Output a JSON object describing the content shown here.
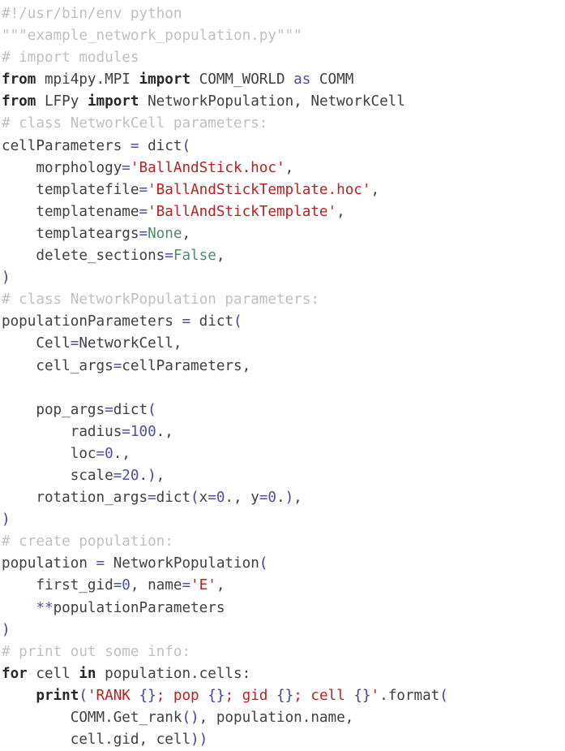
{
  "document": {
    "kind": "python-source-listing",
    "filename": "example_network_population.py",
    "language": "Python",
    "background_color": "#ffffff",
    "line_count": 30
  },
  "theme": {
    "plain": "#404044",
    "comment": "#c0c0c0",
    "keyword": "#26282c",
    "builtin": "#26282c",
    "string": "#ba2121",
    "operator": "#5050a0",
    "number": "#5050a0",
    "constant": "#4f8a6a",
    "brace": "#4040a8"
  },
  "lines": [
    {
      "n": 1,
      "text": "#!/usr/bin/env python",
      "tokens": [
        {
          "t": "#!/usr/bin/env python",
          "c": "comment"
        }
      ]
    },
    {
      "n": 2,
      "text": "\"\"\"example_network_population.py\"\"\"",
      "tokens": [
        {
          "t": "\"\"\"example_network_population.py\"\"\"",
          "c": "comment"
        }
      ]
    },
    {
      "n": 3,
      "text": "# import modules",
      "tokens": [
        {
          "t": "# import modules",
          "c": "comment"
        }
      ]
    },
    {
      "n": 4,
      "text": "from mpi4py.MPI import COMM_WORLD as COMM",
      "tokens": [
        {
          "t": "from",
          "c": "keyword"
        },
        {
          "t": " mpi4py.MPI ",
          "c": "plain"
        },
        {
          "t": "import",
          "c": "keyword"
        },
        {
          "t": " COMM_WORLD ",
          "c": "plain"
        },
        {
          "t": "as",
          "c": "op"
        },
        {
          "t": " COMM",
          "c": "plain"
        }
      ]
    },
    {
      "n": 5,
      "text": "from LFPy import NetworkPopulation, NetworkCell",
      "tokens": [
        {
          "t": "from",
          "c": "keyword"
        },
        {
          "t": " LFPy ",
          "c": "plain"
        },
        {
          "t": "import",
          "c": "keyword"
        },
        {
          "t": " NetworkPopulation, NetworkCell",
          "c": "plain"
        }
      ]
    },
    {
      "n": 6,
      "text": "# class NetworkCell parameters:",
      "tokens": [
        {
          "t": "# class NetworkCell parameters:",
          "c": "comment"
        }
      ]
    },
    {
      "n": 7,
      "text": "cellParameters = dict(",
      "tokens": [
        {
          "t": "cellParameters ",
          "c": "plain"
        },
        {
          "t": "=",
          "c": "op"
        },
        {
          "t": " dict",
          "c": "plain"
        },
        {
          "t": "(",
          "c": "brace"
        }
      ]
    },
    {
      "n": 8,
      "text": "    morphology='BallAndStick.hoc',",
      "tokens": [
        {
          "t": "    morphology",
          "c": "plain"
        },
        {
          "t": "=",
          "c": "op"
        },
        {
          "t": "'BallAndStick.hoc'",
          "c": "string"
        },
        {
          "t": ",",
          "c": "plain"
        }
      ]
    },
    {
      "n": 9,
      "text": "    templatefile='BallAndStickTemplate.hoc',",
      "tokens": [
        {
          "t": "    templatefile",
          "c": "plain"
        },
        {
          "t": "=",
          "c": "op"
        },
        {
          "t": "'BallAndStickTemplate.hoc'",
          "c": "string"
        },
        {
          "t": ",",
          "c": "plain"
        }
      ]
    },
    {
      "n": 10,
      "text": "    templatename='BallAndStickTemplate',",
      "tokens": [
        {
          "t": "    templatename",
          "c": "plain"
        },
        {
          "t": "=",
          "c": "op"
        },
        {
          "t": "'BallAndStickTemplate'",
          "c": "string"
        },
        {
          "t": ",",
          "c": "plain"
        }
      ]
    },
    {
      "n": 11,
      "text": "    templateargs=None,",
      "tokens": [
        {
          "t": "    templateargs",
          "c": "plain"
        },
        {
          "t": "=",
          "c": "op"
        },
        {
          "t": "None",
          "c": "const"
        },
        {
          "t": ",",
          "c": "plain"
        }
      ]
    },
    {
      "n": 12,
      "text": "    delete_sections=False,",
      "tokens": [
        {
          "t": "    delete_sections",
          "c": "plain"
        },
        {
          "t": "=",
          "c": "op"
        },
        {
          "t": "False",
          "c": "const"
        },
        {
          "t": ",",
          "c": "plain"
        }
      ]
    },
    {
      "n": 13,
      "text": ")",
      "tokens": [
        {
          "t": ")",
          "c": "brace"
        }
      ]
    },
    {
      "n": 14,
      "text": "# class NetworkPopulation parameters:",
      "tokens": [
        {
          "t": "# class NetworkPopulation parameters:",
          "c": "comment"
        }
      ]
    },
    {
      "n": 15,
      "text": "populationParameters = dict(",
      "tokens": [
        {
          "t": "populationParameters ",
          "c": "plain"
        },
        {
          "t": "=",
          "c": "op"
        },
        {
          "t": " dict",
          "c": "plain"
        },
        {
          "t": "(",
          "c": "brace"
        }
      ]
    },
    {
      "n": 16,
      "text": "    Cell=NetworkCell,",
      "tokens": [
        {
          "t": "    Cell",
          "c": "plain"
        },
        {
          "t": "=",
          "c": "op"
        },
        {
          "t": "NetworkCell,",
          "c": "plain"
        }
      ]
    },
    {
      "n": 17,
      "text": "    cell_args=cellParameters,",
      "tokens": [
        {
          "t": "    cell_args",
          "c": "plain"
        },
        {
          "t": "=",
          "c": "op"
        },
        {
          "t": "cellParameters,",
          "c": "plain"
        }
      ]
    },
    {
      "n": 18,
      "text": "",
      "tokens": []
    },
    {
      "n": 19,
      "text": "    pop_args=dict(",
      "tokens": [
        {
          "t": "    pop_args",
          "c": "plain"
        },
        {
          "t": "=",
          "c": "op"
        },
        {
          "t": "dict",
          "c": "plain"
        },
        {
          "t": "(",
          "c": "brace"
        }
      ]
    },
    {
      "n": 20,
      "text": "        radius=100.,",
      "tokens": [
        {
          "t": "        radius",
          "c": "plain"
        },
        {
          "t": "=",
          "c": "op"
        },
        {
          "t": "100",
          "c": "number"
        },
        {
          "t": ".,",
          "c": "plain"
        }
      ]
    },
    {
      "n": 21,
      "text": "        loc=0.,",
      "tokens": [
        {
          "t": "        loc",
          "c": "plain"
        },
        {
          "t": "=",
          "c": "op"
        },
        {
          "t": "0",
          "c": "number"
        },
        {
          "t": ".,",
          "c": "plain"
        }
      ]
    },
    {
      "n": 22,
      "text": "        scale=20.),",
      "tokens": [
        {
          "t": "        scale",
          "c": "plain"
        },
        {
          "t": "=",
          "c": "op"
        },
        {
          "t": "20",
          "c": "number"
        },
        {
          "t": ".",
          "c": "plain"
        },
        {
          "t": ")",
          "c": "brace"
        },
        {
          "t": ",",
          "c": "plain"
        }
      ]
    },
    {
      "n": 23,
      "text": "    rotation_args=dict(x=0., y=0.),",
      "tokens": [
        {
          "t": "    rotation_args",
          "c": "plain"
        },
        {
          "t": "=",
          "c": "op"
        },
        {
          "t": "dict",
          "c": "plain"
        },
        {
          "t": "(",
          "c": "brace"
        },
        {
          "t": "x",
          "c": "plain"
        },
        {
          "t": "=",
          "c": "op"
        },
        {
          "t": "0",
          "c": "number"
        },
        {
          "t": "., y",
          "c": "plain"
        },
        {
          "t": "=",
          "c": "op"
        },
        {
          "t": "0",
          "c": "number"
        },
        {
          "t": ".",
          "c": "plain"
        },
        {
          "t": ")",
          "c": "brace"
        },
        {
          "t": ",",
          "c": "plain"
        }
      ]
    },
    {
      "n": 24,
      "text": ")",
      "tokens": [
        {
          "t": ")",
          "c": "brace"
        }
      ]
    },
    {
      "n": 25,
      "text": "# create population:",
      "tokens": [
        {
          "t": "# create population:",
          "c": "comment"
        }
      ]
    },
    {
      "n": 26,
      "text": "population = NetworkPopulation(",
      "tokens": [
        {
          "t": "population ",
          "c": "plain"
        },
        {
          "t": "=",
          "c": "op"
        },
        {
          "t": " NetworkPopulation",
          "c": "plain"
        },
        {
          "t": "(",
          "c": "brace"
        }
      ]
    },
    {
      "n": 27,
      "text": "    first_gid=0, name='E',",
      "tokens": [
        {
          "t": "    first_gid",
          "c": "plain"
        },
        {
          "t": "=",
          "c": "op"
        },
        {
          "t": "0",
          "c": "number"
        },
        {
          "t": ", name",
          "c": "plain"
        },
        {
          "t": "=",
          "c": "op"
        },
        {
          "t": "'E'",
          "c": "string"
        },
        {
          "t": ",",
          "c": "plain"
        }
      ]
    },
    {
      "n": 28,
      "text": "    **populationParameters",
      "tokens": [
        {
          "t": "    ",
          "c": "plain"
        },
        {
          "t": "**",
          "c": "op"
        },
        {
          "t": "populationParameters",
          "c": "plain"
        }
      ]
    },
    {
      "n": 29,
      "text": ")",
      "tokens": [
        {
          "t": ")",
          "c": "brace"
        }
      ]
    },
    {
      "n": 30,
      "text": "# print out some info:",
      "tokens": [
        {
          "t": "# print out some info:",
          "c": "comment"
        }
      ]
    },
    {
      "n": 31,
      "text": "for cell in population.cells:",
      "tokens": [
        {
          "t": "for",
          "c": "keyword"
        },
        {
          "t": " cell ",
          "c": "plain"
        },
        {
          "t": "in",
          "c": "keyword"
        },
        {
          "t": " population.cells:",
          "c": "plain"
        }
      ]
    },
    {
      "n": 32,
      "text": "    print('RANK {}; pop {}; gid {}; cell {}'.format(",
      "tokens": [
        {
          "t": "    ",
          "c": "plain"
        },
        {
          "t": "print",
          "c": "builtin"
        },
        {
          "t": "(",
          "c": "brace"
        },
        {
          "t": "'RANK ",
          "c": "string"
        },
        {
          "t": "{}",
          "c": "brace"
        },
        {
          "t": "; pop ",
          "c": "string"
        },
        {
          "t": "{}",
          "c": "brace"
        },
        {
          "t": "; gid ",
          "c": "string"
        },
        {
          "t": "{}",
          "c": "brace"
        },
        {
          "t": "; cell ",
          "c": "string"
        },
        {
          "t": "{}",
          "c": "brace"
        },
        {
          "t": "'",
          "c": "string"
        },
        {
          "t": ".format",
          "c": "plain"
        },
        {
          "t": "(",
          "c": "brace"
        }
      ]
    },
    {
      "n": 33,
      "text": "        COMM.Get_rank(), population.name,",
      "tokens": [
        {
          "t": "        COMM.Get_rank",
          "c": "plain"
        },
        {
          "t": "()",
          "c": "brace"
        },
        {
          "t": ", population.name,",
          "c": "plain"
        }
      ]
    },
    {
      "n": 34,
      "text": "        cell.gid, cell))",
      "tokens": [
        {
          "t": "        cell.gid, cell",
          "c": "plain"
        },
        {
          "t": "))",
          "c": "brace"
        }
      ]
    }
  ]
}
